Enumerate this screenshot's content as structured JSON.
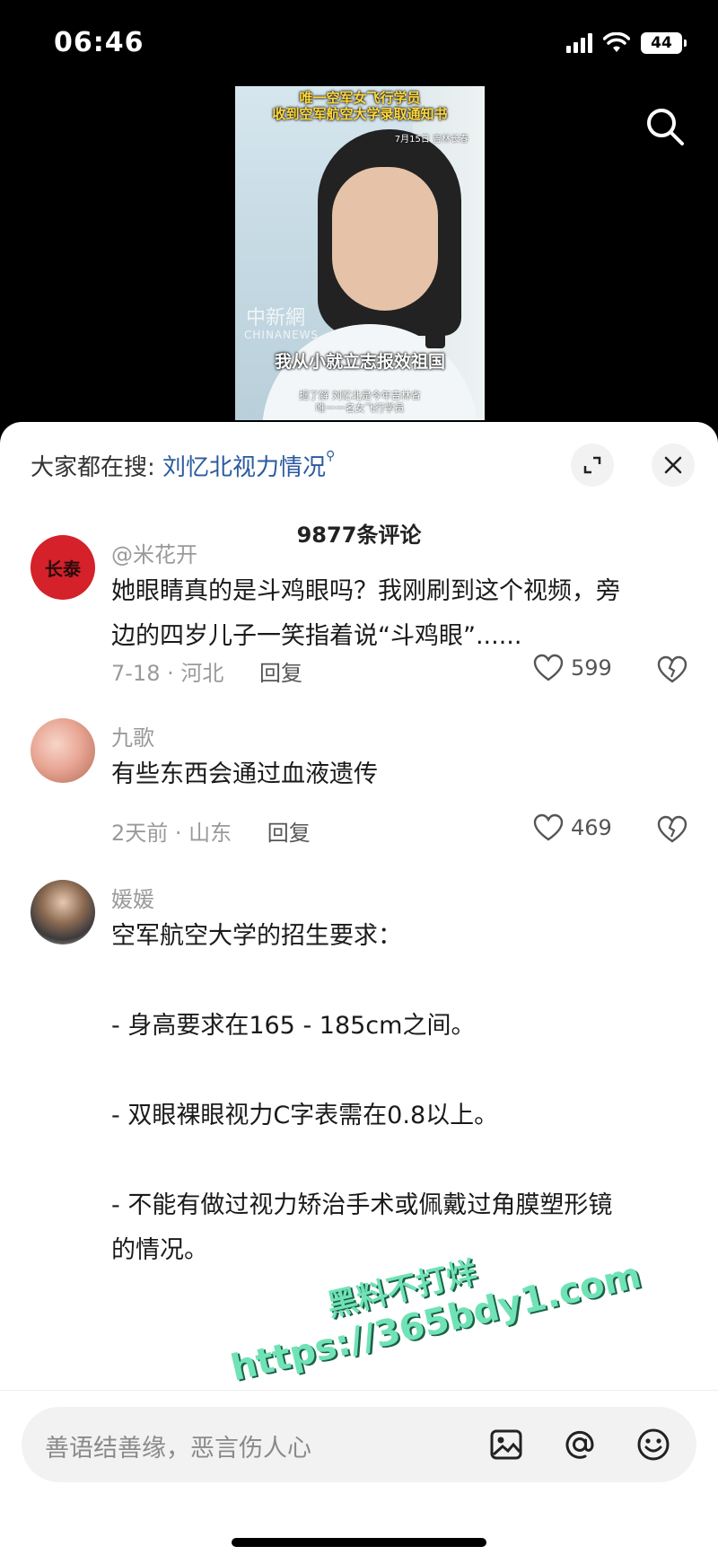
{
  "status_bar": {
    "time": "06:46",
    "battery": "44"
  },
  "video": {
    "title_line1": "唯一空军女飞行学员",
    "title_line2": "收到空军航空大学录取通知书",
    "date": "7月15日 吉林长春",
    "watermark_logo": "中新網",
    "watermark_text": "CHINANEWS",
    "subtitle": "我从小就立志报效祖国",
    "caption_line1": "据了解 刘忆北是今年吉林省",
    "caption_line2": "唯一一名女飞行学员"
  },
  "sheet": {
    "hot_search_prefix": "大家都在搜:",
    "hot_search_term": "刘忆北视力情况",
    "comment_count": "9877条评论"
  },
  "comments": [
    {
      "username": "@米花开",
      "avatar_text": "长泰",
      "text_lines": [
        "她眼睛真的是斗鸡眼吗？我刚刷到这个视频，旁",
        "边的四岁儿子一笑指着说“斗鸡眼”......"
      ],
      "meta": "7-18 · 河北",
      "reply": "回复",
      "likes": "599"
    },
    {
      "username": "九歌",
      "text_lines": [
        "有些东西会通过血液遗传"
      ],
      "meta": "2天前 · 山东",
      "reply": "回复",
      "likes": "469"
    },
    {
      "username": "媛媛",
      "text_lines": [
        "空军航空大学的招生要求：",
        "",
        "- 身高要求在165 - 185cm之间。",
        "",
        "- 双眼裸眼视力C字表需在0.8以上。",
        "",
        "- 不能有做过视力矫治手术或佩戴过角膜塑形镜",
        "的情况。"
      ]
    }
  ],
  "overlay_watermark": {
    "line1": "黑料不打烊",
    "line2": "https://365bdy1.com"
  },
  "input_bar": {
    "placeholder": "善语结善缘，恶言伤人心"
  },
  "colors": {
    "link": "#2a5a9e",
    "watermark": "#6fe3b6"
  }
}
